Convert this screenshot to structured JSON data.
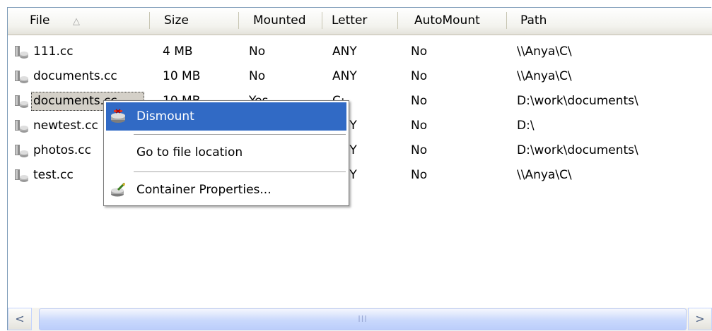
{
  "columns": [
    "File",
    "Size",
    "Mounted",
    "Letter",
    "AutoMount",
    "Path"
  ],
  "rows": [
    {
      "file": "111.cc",
      "size": "4 MB",
      "mounted": "No",
      "letter": "ANY",
      "automount": "No",
      "path": "\\\\Anya\\C\\"
    },
    {
      "file": "documents.cc",
      "size": "10 MB",
      "mounted": "No",
      "letter": "ANY",
      "automount": "No",
      "path": "\\\\Anya\\C\\"
    },
    {
      "file": "documents.cc",
      "size": "10 MB",
      "mounted": "Yes",
      "letter": "C:",
      "automount": "No",
      "path": "D:\\work\\documents\\"
    },
    {
      "file": "newtest.cc",
      "size": "",
      "mounted": "",
      "letter": "ANY",
      "automount": "No",
      "path": "D:\\"
    },
    {
      "file": "photos.cc",
      "size": "",
      "mounted": "",
      "letter": "ANY",
      "automount": "No",
      "path": "D:\\work\\documents\\"
    },
    {
      "file": "test.cc",
      "size": "",
      "mounted": "",
      "letter": "ANY",
      "automount": "No",
      "path": "\\\\Anya\\C\\"
    }
  ],
  "context_menu": {
    "items": [
      {
        "label": "Dismount",
        "icon": "dismount-icon",
        "highlighted": true
      },
      {
        "label": "Go to file location",
        "icon": "",
        "highlighted": false
      },
      {
        "label": "Container Properties...",
        "icon": "properties-icon",
        "highlighted": false
      }
    ]
  },
  "scrollbar": {
    "left_arrow": "<",
    "right_arrow": ">",
    "grip": "III"
  },
  "header_sort_glyph": "△",
  "colors": {
    "highlight": "#316ac5",
    "header_bg": "#ebeadb",
    "border": "#7f9db9"
  }
}
